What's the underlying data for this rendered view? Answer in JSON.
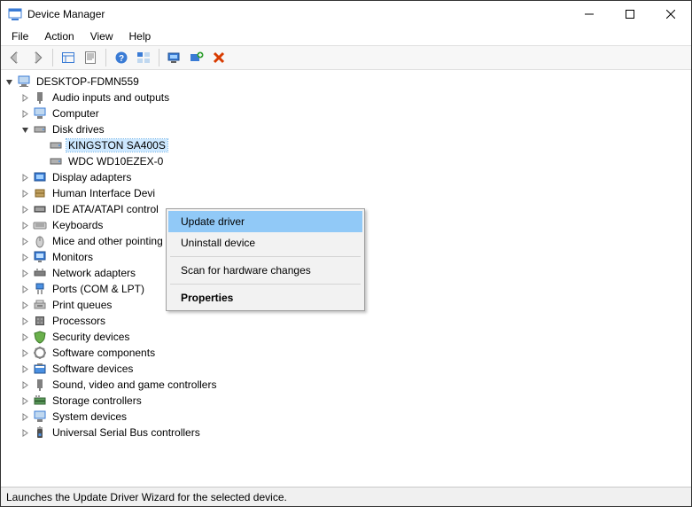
{
  "window": {
    "title": "Device Manager"
  },
  "menubar": {
    "items": [
      "File",
      "Action",
      "View",
      "Help"
    ]
  },
  "toolbar": {
    "back": "back-arrow-icon",
    "forward": "forward-arrow-icon",
    "show_hidden": "show-hidden-icon",
    "properties": "properties-icon",
    "help": "help-icon",
    "action_views": "views-icon",
    "scan": "scan-hardware-icon",
    "add_legacy": "add-legacy-icon",
    "uninstall": "uninstall-icon"
  },
  "tree": {
    "root": "DESKTOP-FDMN559",
    "categories": [
      {
        "label": "Audio inputs and outputs",
        "expanded": false
      },
      {
        "label": "Computer",
        "expanded": false
      },
      {
        "label": "Disk drives",
        "expanded": true,
        "children": [
          {
            "label": "KINGSTON SA400S",
            "selected": true
          },
          {
            "label": "WDC WD10EZEX-0"
          }
        ]
      },
      {
        "label": "Display adapters",
        "expanded": false
      },
      {
        "label": "Human Interface Devi",
        "expanded": false
      },
      {
        "label": "IDE ATA/ATAPI control",
        "expanded": false
      },
      {
        "label": "Keyboards",
        "expanded": false
      },
      {
        "label": "Mice and other pointing devices",
        "expanded": false
      },
      {
        "label": "Monitors",
        "expanded": false
      },
      {
        "label": "Network adapters",
        "expanded": false
      },
      {
        "label": "Ports (COM & LPT)",
        "expanded": false
      },
      {
        "label": "Print queues",
        "expanded": false
      },
      {
        "label": "Processors",
        "expanded": false
      },
      {
        "label": "Security devices",
        "expanded": false
      },
      {
        "label": "Software components",
        "expanded": false
      },
      {
        "label": "Software devices",
        "expanded": false
      },
      {
        "label": "Sound, video and game controllers",
        "expanded": false
      },
      {
        "label": "Storage controllers",
        "expanded": false
      },
      {
        "label": "System devices",
        "expanded": false
      },
      {
        "label": "Universal Serial Bus controllers",
        "expanded": false
      }
    ]
  },
  "context_menu": {
    "items": [
      {
        "label": "Update driver",
        "highlight": true
      },
      {
        "label": "Uninstall device"
      },
      {
        "separator": true
      },
      {
        "label": "Scan for hardware changes"
      },
      {
        "separator": true
      },
      {
        "label": "Properties",
        "bold": true
      }
    ]
  },
  "statusbar": {
    "text": "Launches the Update Driver Wizard for the selected device."
  }
}
